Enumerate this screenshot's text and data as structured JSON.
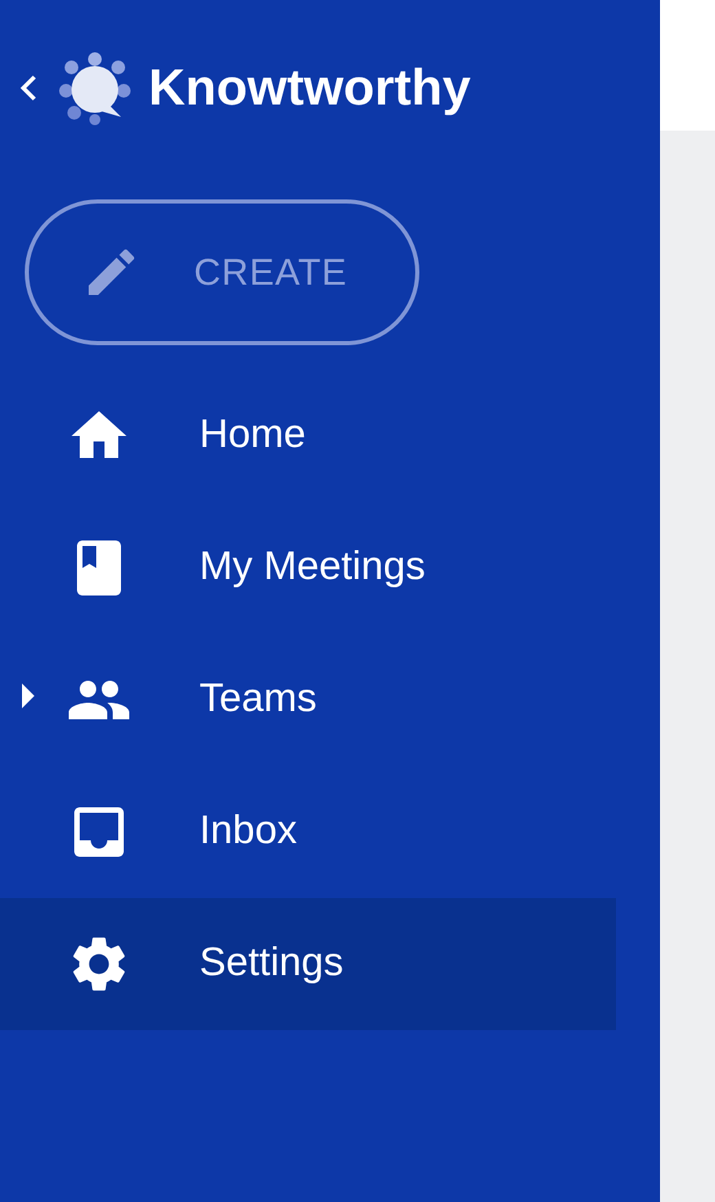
{
  "sidebar": {
    "title": "Knowtworthy",
    "create_button": {
      "label": "CREATE",
      "disabled": true
    },
    "items": [
      {
        "label": "Home",
        "selected": false
      },
      {
        "label": "My Meetings",
        "selected": false
      },
      {
        "label": "Teams",
        "selected": false,
        "expanded": false
      },
      {
        "label": "Inbox",
        "selected": false
      },
      {
        "label": "Settings",
        "selected": true
      }
    ]
  }
}
